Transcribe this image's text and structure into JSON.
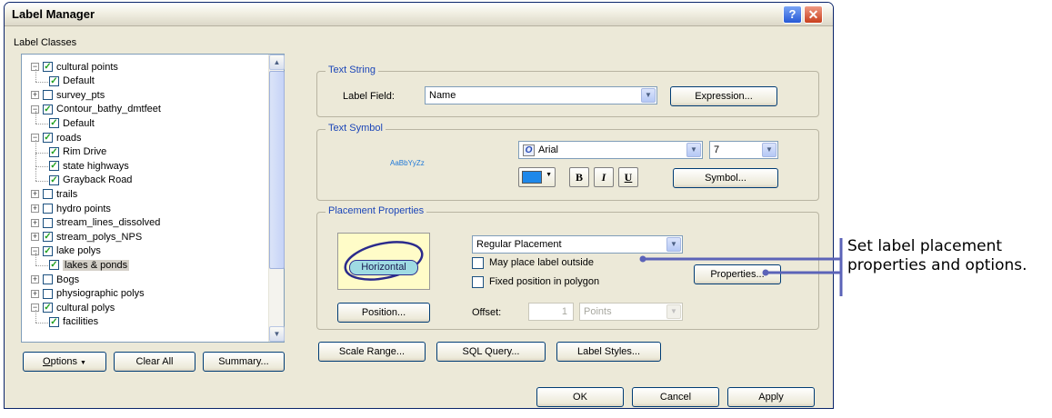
{
  "window": {
    "title": "Label Manager",
    "help_glyph": "?",
    "close_glyph": "✕"
  },
  "label_classes": {
    "heading": "Label Classes",
    "tree": [
      {
        "label": "cultural points",
        "level": 0,
        "expander": "minus",
        "checked": true
      },
      {
        "label": "Default",
        "level": 1,
        "expander": "none",
        "checked": true
      },
      {
        "label": "survey_pts",
        "level": 0,
        "expander": "plus",
        "checked": false
      },
      {
        "label": "Contour_bathy_dmtfeet",
        "level": 0,
        "expander": "minus",
        "checked": true
      },
      {
        "label": "Default",
        "level": 1,
        "expander": "none",
        "checked": true
      },
      {
        "label": "roads",
        "level": 0,
        "expander": "minus",
        "checked": true
      },
      {
        "label": "Rim Drive",
        "level": 1,
        "expander": "none",
        "checked": true
      },
      {
        "label": "state highways",
        "level": 1,
        "expander": "none",
        "checked": true
      },
      {
        "label": "Grayback Road",
        "level": 1,
        "expander": "none",
        "checked": true
      },
      {
        "label": "trails",
        "level": 0,
        "expander": "plus",
        "checked": false
      },
      {
        "label": "hydro points",
        "level": 0,
        "expander": "plus",
        "checked": false
      },
      {
        "label": "stream_lines_dissolved",
        "level": 0,
        "expander": "plus",
        "checked": false
      },
      {
        "label": "stream_polys_NPS",
        "level": 0,
        "expander": "plus",
        "checked": true
      },
      {
        "label": "lake polys",
        "level": 0,
        "expander": "minus",
        "checked": true
      },
      {
        "label": "lakes & ponds",
        "level": 1,
        "expander": "none",
        "checked": true,
        "selected": true
      },
      {
        "label": "Bogs",
        "level": 0,
        "expander": "plus",
        "checked": false
      },
      {
        "label": "physiographic polys",
        "level": 0,
        "expander": "plus",
        "checked": false
      },
      {
        "label": "cultural polys",
        "level": 0,
        "expander": "minus",
        "checked": true
      },
      {
        "label": "facilities",
        "level": 1,
        "expander": "none",
        "checked": true
      }
    ],
    "options_label": "Options",
    "options_mnemonic": "O",
    "options_rest": "ptions",
    "clear_all_label": "Clear All",
    "summary_label": "Summary..."
  },
  "text_string": {
    "title": "Text String",
    "label_field_caption": "Label Field:",
    "label_field_value": "Name",
    "expression_label": "Expression..."
  },
  "text_symbol": {
    "title": "Text Symbol",
    "preview": "AaBbYyZz",
    "font_name": "Arial",
    "font_icon_glyph": "O",
    "font_size": "7",
    "color": "#1e88ea",
    "bold_label": "B",
    "italic_label": "I",
    "underline_label": "U",
    "symbol_label": "Symbol..."
  },
  "placement": {
    "title": "Placement Properties",
    "preview_text": "Horizontal",
    "placement_value": "Regular Placement",
    "may_place_outside_label": "May place label outside",
    "may_place_outside_checked": false,
    "fixed_position_label": "Fixed position in polygon",
    "fixed_position_checked": false,
    "properties_label": "Properties...",
    "position_label": "Position...",
    "offset_caption": "Offset:",
    "offset_value": "1",
    "offset_units": "Points"
  },
  "bottom_buttons": {
    "scale_range": "Scale Range...",
    "sql_query": "SQL Query...",
    "label_styles": "Label Styles...",
    "ok": "OK",
    "cancel": "Cancel",
    "apply": "Apply"
  },
  "callout": {
    "text": "Set label placement properties and options.",
    "color": "#5b63b8"
  }
}
